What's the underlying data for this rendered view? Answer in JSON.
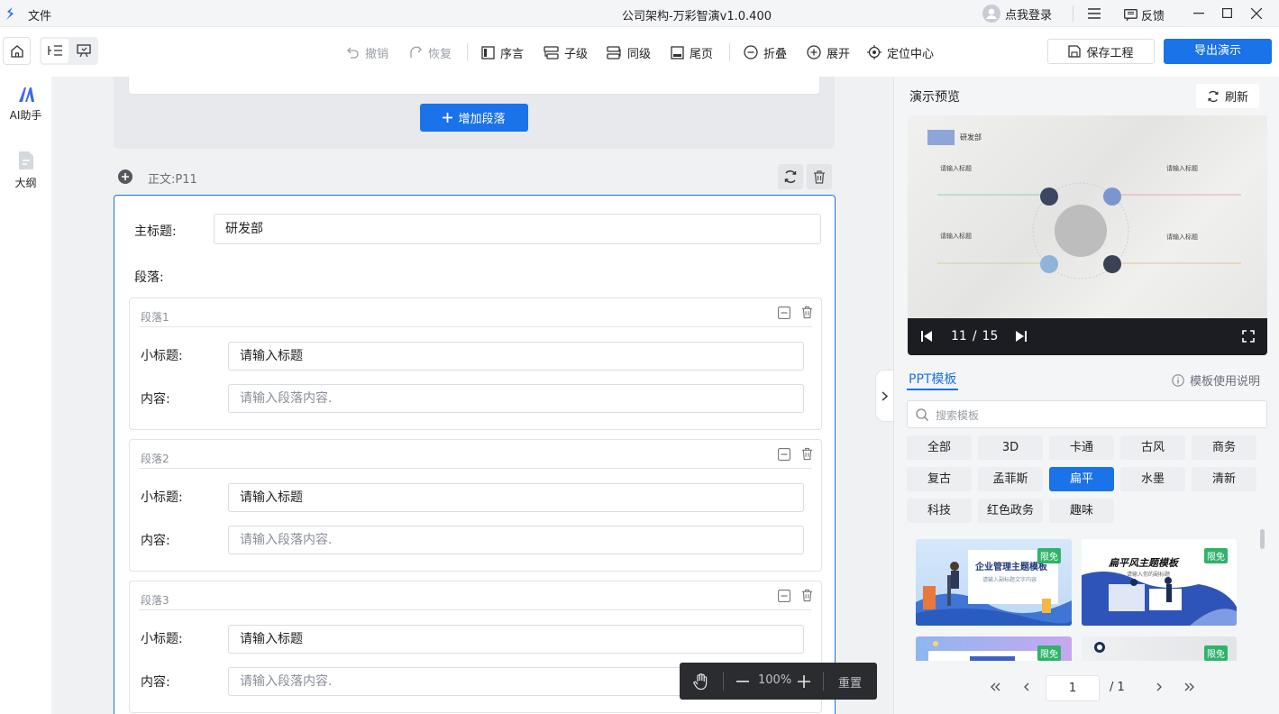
{
  "titlebar": {
    "file_menu": "文件",
    "title": "公司架构-万彩智演v1.0.400",
    "login": "点我登录",
    "feedback": "反馈"
  },
  "toolbar": {
    "undo": "撤销",
    "redo": "恢复",
    "preface": "序言",
    "child": "子级",
    "sibling": "同级",
    "ending": "尾页",
    "collapse": "折叠",
    "expand": "展开",
    "locate": "定位中心",
    "save": "保存工程",
    "export": "导出演示"
  },
  "rail": {
    "ai_logo": "AI",
    "ai": "AI助手",
    "outline": "大纲"
  },
  "editor": {
    "add_paragraph": "增加段落",
    "section_label": "正文:P11",
    "main_title_label": "主标题:",
    "main_title_value": "研发部",
    "paragraphs_label": "段落:",
    "paragraphs": [
      {
        "name": "段落1",
        "subtitle_label": "小标题:",
        "subtitle_value": "请输入标题",
        "content_label": "内容:",
        "content_placeholder": "请输入段落内容."
      },
      {
        "name": "段落2",
        "subtitle_label": "小标题:",
        "subtitle_value": "请输入标题",
        "content_label": "内容:",
        "content_placeholder": "请输入段落内容."
      },
      {
        "name": "段落3",
        "subtitle_label": "小标题:",
        "subtitle_value": "请输入标题",
        "content_label": "内容:",
        "content_placeholder": "请输入段落内容."
      }
    ],
    "zoom": {
      "value": "100%",
      "reset": "重置"
    }
  },
  "preview": {
    "title": "演示预览",
    "refresh": "刷新",
    "slide": {
      "heading": "研发部",
      "labels": [
        "请输入标题",
        "请输入标题",
        "请输入标题",
        "请输入标题"
      ]
    },
    "player": {
      "current": "11",
      "total": "15",
      "separator": "/"
    }
  },
  "templates": {
    "tab": "PPT模板",
    "help": "模板使用说明",
    "search_placeholder": "搜索模板",
    "categories": [
      "全部",
      "3D",
      "卡通",
      "古风",
      "商务",
      "复古",
      "孟菲斯",
      "扁平",
      "水墨",
      "清新",
      "科技",
      "红色政务",
      "趣味"
    ],
    "active_category": "扁平",
    "badge": "限免",
    "thumbs": [
      {
        "title": "企业管理主题模板",
        "subtitle": "请输入副标题文字内容"
      },
      {
        "title": "扁平风主题模板",
        "subtitle": "请输入你的副标题"
      }
    ],
    "pagination": {
      "page": "1",
      "total": "/ 1"
    }
  },
  "colors": {
    "accent": "#1a73e8",
    "badge": "#2fb36a",
    "player_bg": "#1c1d22"
  }
}
